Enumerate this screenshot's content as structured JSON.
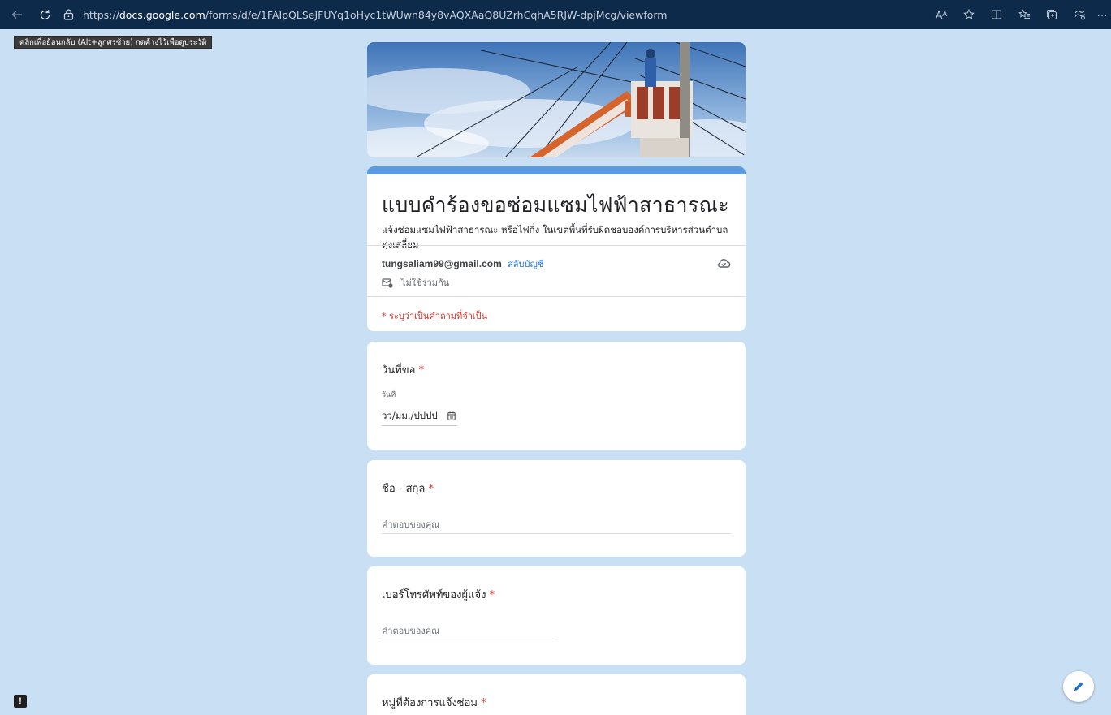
{
  "browser": {
    "url_prefix": "https://",
    "url_host": "docs.google.com",
    "url_path": "/forms/d/e/1FAIpQLSeJFUYq1oHyc1tWUwn84y8vAQXAaQ8UZrhCqhA5RJW-dpjMcg/viewform",
    "back_tooltip": "คลิกเพื่อย้อนกลับ (Alt+ลูกศรซ้าย) กดค้างไว้เพื่อดูประวัติ",
    "right_icons": [
      "read-aloud-icon",
      "favorite-star-icon",
      "split-screen-icon",
      "favorites-icon",
      "collections-icon",
      "extensions-icon",
      "more-icon"
    ],
    "read_aloud_glyph": "Aᴬ",
    "more_glyph": "···"
  },
  "form": {
    "title": "แบบคำร้องขอซ่อมแซมไฟฟ้าสาธารณะ",
    "description": "แจ้งซ่อมแซมไฟฟ้าสาธารณะ หรือไฟกิ่ง ในเขตพื้นที่รับผิดชอบองค์การบริหารส่วนตำบลทุ่งเสลี่ยม",
    "account_email": "tungsaliam99@gmail.com",
    "switch_account": "สลับบัญชี",
    "not_shared": "ไม่ใช้ร่วมกัน",
    "required_note": "* ระบุว่าเป็นคำถามที่จำเป็น",
    "accent_color": "#5b9be2",
    "background_color": "#c9dff3"
  },
  "questions": {
    "date": {
      "title": "วันที่ขอ",
      "required_mark": "*",
      "sub_label": "วันที่",
      "placeholder": "วว/มม./ปปปป"
    },
    "name": {
      "title": "ชื่อ - สกุล",
      "required_mark": "*",
      "placeholder": "คำตอบของคุณ"
    },
    "phone": {
      "title": "เบอร์โทรศัพท์ของผู้แจ้ง",
      "required_mark": "*",
      "placeholder": "คำตอบของคุณ"
    },
    "village": {
      "title": "หมู่ที่ต้องการแจ้งซ่อม",
      "required_mark": "*"
    }
  },
  "feedback_glyph": "!"
}
